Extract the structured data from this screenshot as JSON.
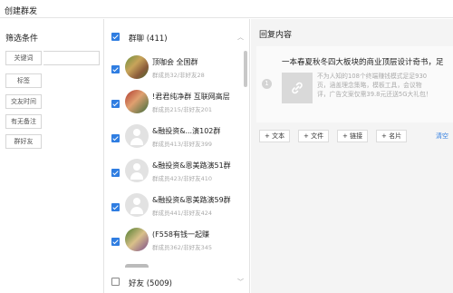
{
  "window": {
    "title": "创建群发"
  },
  "filter": {
    "header": "筛选条件",
    "buttons": [
      "关键词",
      "标签",
      "交友时间",
      "有无备注",
      "群好友"
    ],
    "keyword_value": ""
  },
  "groups": {
    "header": {
      "label": "群聊",
      "count": "(411)",
      "checked": true
    },
    "items": [
      {
        "name": "顶咖会  全国群",
        "meta": "群成员32/非好友28",
        "checked": true
      },
      {
        "name": "!君君纯净群 互联网高层",
        "meta": "群成员215/非好友201",
        "checked": true
      },
      {
        "name": "&融投资&...演102群",
        "meta": "群成员413/非好友399",
        "checked": true
      },
      {
        "name": "&融投资&恩美路演51群",
        "meta": "群成员423/非好友410",
        "checked": true
      },
      {
        "name": "&融投资&恩美路演59群",
        "meta": "群成员441/非好友424",
        "checked": true
      },
      {
        "name": "(F558有钱一起赚",
        "meta": "群成员362/非好友345",
        "checked": true
      }
    ],
    "footer": {
      "label": "好友",
      "count": "(5009)",
      "checked": false
    },
    "colors": {
      "accent": "#2f7de1"
    }
  },
  "reply": {
    "header": "回复内容",
    "message": {
      "index": "1",
      "title": "一本春夏秋冬四大板块的商业顶层设计奇书，足",
      "desc_lines": [
        "不为人知的108个终端赚钱模式足足930",
        "页，涵盖理念策略，模板工具，会议物",
        "评，广告文案仅需39.8元还送5G大礼包！"
      ],
      "thumb_icon": "link-icon"
    },
    "actions": [
      "+ 文本",
      "+ 文件",
      "+ 链接",
      "+ 名片"
    ],
    "clear": "清空"
  }
}
